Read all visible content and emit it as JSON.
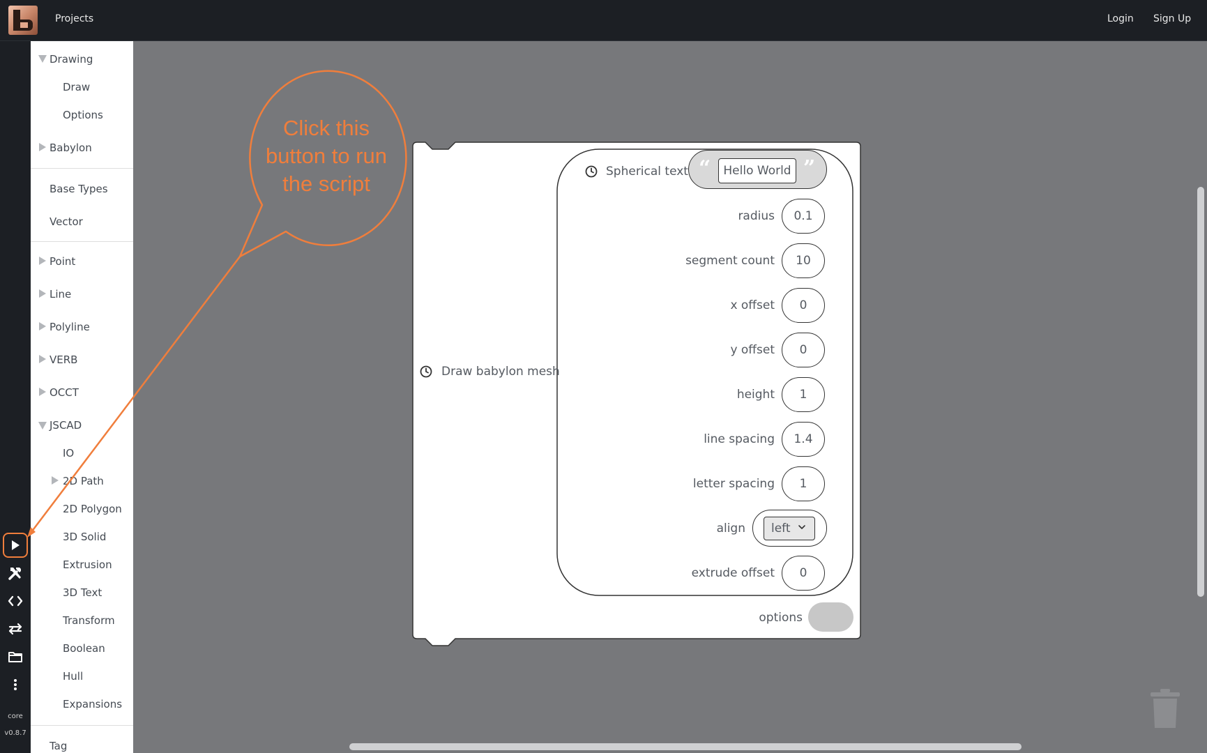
{
  "topbar": {
    "projects": "Projects",
    "login": "Login",
    "signup": "Sign Up"
  },
  "rail": {
    "core": "core",
    "version": "v0.8.7"
  },
  "sidebar": {
    "items": [
      {
        "label": "Drawing",
        "expander": "down"
      },
      {
        "label": "Draw"
      },
      {
        "label": "Options"
      },
      {
        "label": "Babylon",
        "expander": "right"
      },
      {
        "label": "Base Types"
      },
      {
        "label": "Vector"
      },
      {
        "label": "Point",
        "expander": "right"
      },
      {
        "label": "Line",
        "expander": "right"
      },
      {
        "label": "Polyline",
        "expander": "right"
      },
      {
        "label": "VERB",
        "expander": "right"
      },
      {
        "label": "OCCT",
        "expander": "right"
      },
      {
        "label": "JSCAD",
        "expander": "down"
      },
      {
        "label": "IO"
      },
      {
        "label": "2D Path",
        "expander": "right"
      },
      {
        "label": "2D Polygon"
      },
      {
        "label": "3D Solid"
      },
      {
        "label": "Extrusion"
      },
      {
        "label": "3D Text"
      },
      {
        "label": "Transform"
      },
      {
        "label": "Boolean"
      },
      {
        "label": "Hull"
      },
      {
        "label": "Expansions"
      },
      {
        "label": "Tag"
      }
    ]
  },
  "callout": {
    "line1": "Click this",
    "line2": "button to run",
    "line3": "the script",
    "color": "#f07e3c"
  },
  "block": {
    "outer_label": "Draw babylon mesh",
    "inner_label": "Spherical text",
    "text_value": "Hello World",
    "params": [
      {
        "label": "radius",
        "value": "0.1"
      },
      {
        "label": "segment count",
        "value": "10"
      },
      {
        "label": "x offset",
        "value": "0"
      },
      {
        "label": "y offset",
        "value": "0"
      },
      {
        "label": "height",
        "value": "1"
      },
      {
        "label": "line spacing",
        "value": "1.4"
      },
      {
        "label": "letter spacing",
        "value": "1"
      }
    ],
    "align_label": "align",
    "align_value": "left",
    "extrude_label": "extrude offset",
    "extrude_value": "0",
    "options_label": "options"
  }
}
